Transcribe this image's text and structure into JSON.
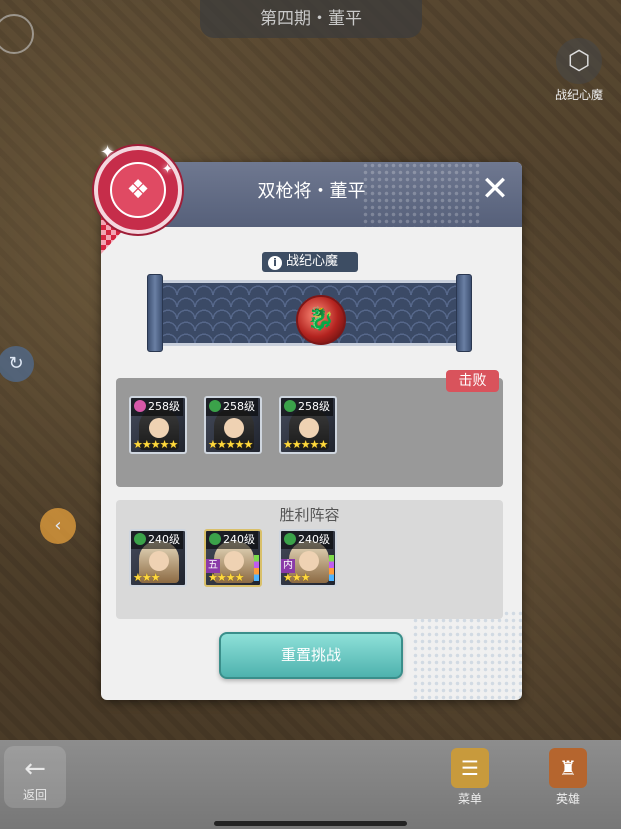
{
  "top_bar": {
    "title": "第四期・董平"
  },
  "top_right_button": {
    "label": "战纪心魔",
    "icon": "hexagon-icon"
  },
  "bottom_bar": {
    "back_label": "返回",
    "items": [
      {
        "label": "菜单",
        "icon": "menu-scroll-icon"
      },
      {
        "label": "英雄",
        "icon": "rooster-hero-icon"
      }
    ]
  },
  "dialog": {
    "title": "双枪将・董平",
    "close_icon": "close-icon",
    "demon_section": {
      "label": "战纪心魔",
      "info_glyph": "i"
    },
    "enemy_panel": {
      "result_tag": "击败",
      "heroes": [
        {
          "level": "258级",
          "faction": "pink",
          "stars": "★★★★★"
        },
        {
          "level": "258级",
          "faction": "green",
          "stars": "★★★★★"
        },
        {
          "level": "258级",
          "faction": "green",
          "stars": "★★★★★"
        }
      ]
    },
    "win_panel": {
      "title": "胜利阵容",
      "heroes": [
        {
          "level": "240级",
          "faction": "green",
          "stars": "★★★",
          "role": ""
        },
        {
          "level": "240级",
          "faction": "green",
          "stars": "★★★★",
          "role": "五"
        },
        {
          "level": "240级",
          "faction": "green",
          "stars": "★★★",
          "role": "内"
        }
      ]
    },
    "reset_button": "重置挑战"
  },
  "colors": {
    "header": "#5e687f",
    "badge": "#c62d4a",
    "defeat_tag": "#d9535c",
    "reset_button": "#6cc9c3"
  }
}
